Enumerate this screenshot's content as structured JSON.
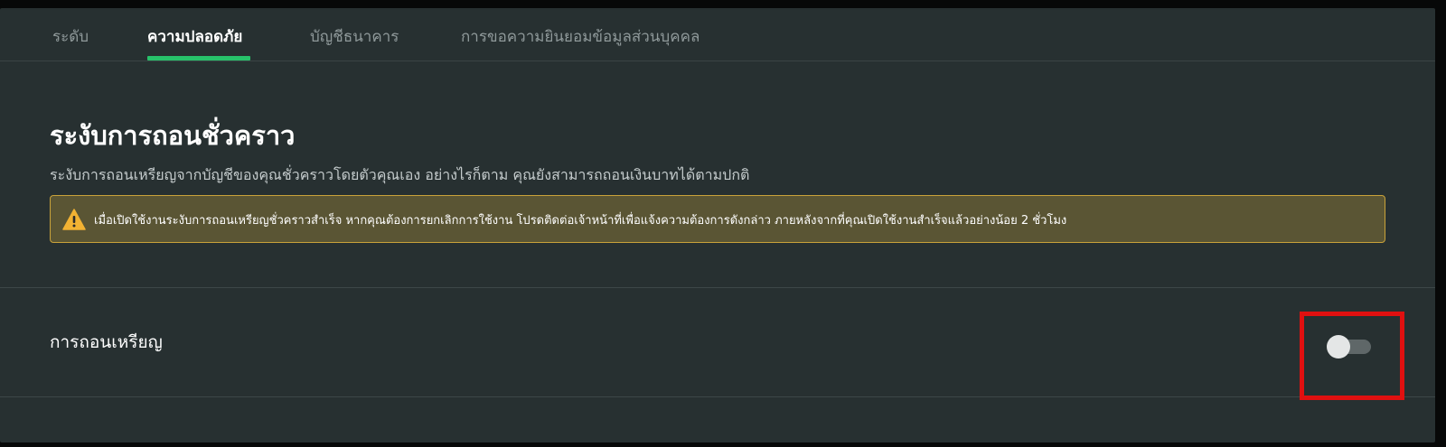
{
  "tabs": [
    {
      "label": "ระดับ",
      "active": false
    },
    {
      "label": "ความปลอดภัย",
      "active": true
    },
    {
      "label": "บัญชีธนาคาร",
      "active": false
    },
    {
      "label": "การขอความยินยอมข้อมูลส่วนบุคคล",
      "active": false
    }
  ],
  "section": {
    "title": "ระงับการถอนชั่วคราว",
    "description": "ระงับการถอนเหรียญจากบัญชีของคุณชั่วคราวโดยตัวคุณเอง อย่างไรก็ตาม คุณยังสามารถถอนเงินบาทได้ตามปกติ"
  },
  "warning": {
    "icon": "warning-triangle-icon",
    "text": "เมื่อเปิดใช้งานระงับการถอนเหรียญชั่วคราวสำเร็จ หากคุณต้องการยกเลิกการใช้งาน โปรดติดต่อเจ้าหน้าที่เพื่อแจ้งความต้องการดังกล่าว ภายหลังจากที่คุณเปิดใช้งานสำเร็จแล้วอย่างน้อย 2 ชั่วโมง"
  },
  "setting_row": {
    "label": "การถอนเหรียญ",
    "toggle_on": false
  },
  "colors": {
    "background": "#273031",
    "accent": "#27c26a",
    "warning_bg": "#5a5534",
    "warning_border": "#c9a23a",
    "highlight": "#e01010"
  }
}
